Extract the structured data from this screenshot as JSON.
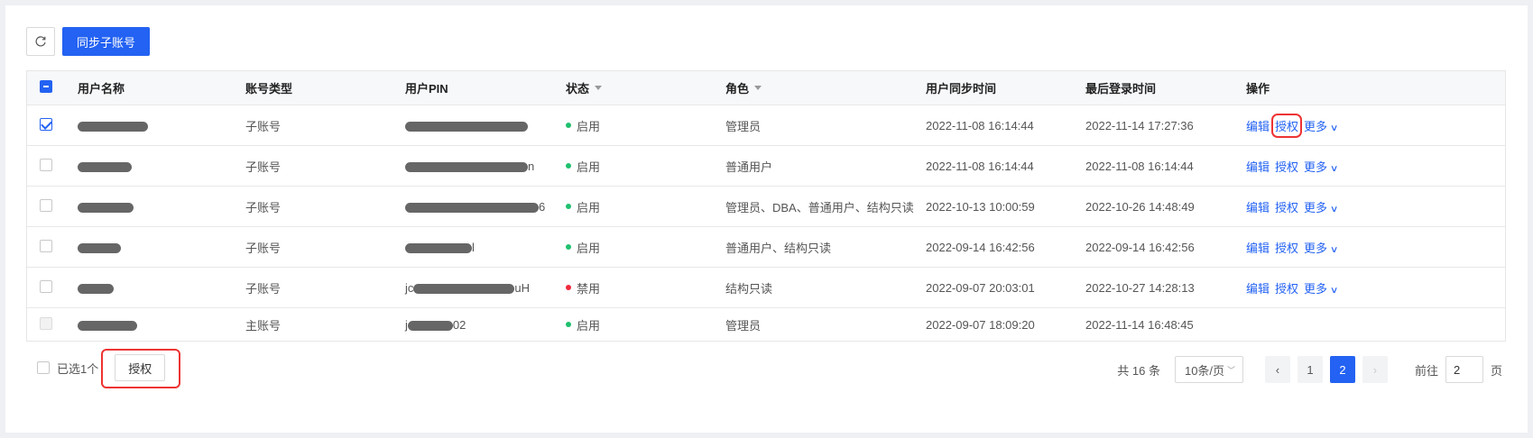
{
  "toolbar": {
    "refresh_icon": "refresh-icon",
    "sync_button": "同步子账号"
  },
  "table": {
    "headers": {
      "name": "用户名称",
      "type": "账号类型",
      "pin": "用户PIN",
      "status": "状态",
      "role": "角色",
      "sync_time": "用户同步时间",
      "login_time": "最后登录时间",
      "ops": "操作"
    },
    "ops_labels": {
      "edit": "编辑",
      "auth": "授权",
      "more": "更多"
    },
    "rows": [
      {
        "checked": true,
        "pin_suffix": "",
        "type": "子账号",
        "status": "启用",
        "status_color": "#1fc06f",
        "role": "管理员",
        "sync": "2022-11-08 16:14:44",
        "login": "2022-11-14 17:27:36"
      },
      {
        "checked": false,
        "pin_suffix": "n",
        "type": "子账号",
        "status": "启用",
        "status_color": "#1fc06f",
        "role": "普通用户",
        "sync": "2022-11-08 16:14:44",
        "login": "2022-11-08 16:14:44"
      },
      {
        "checked": false,
        "pin_suffix": "6",
        "type": "子账号",
        "status": "启用",
        "status_color": "#1fc06f",
        "role": "管理员、DBA、普通用户、结构只读",
        "sync": "2022-10-13 10:00:59",
        "login": "2022-10-26 14:48:49"
      },
      {
        "checked": false,
        "pin_suffix": "l",
        "type": "子账号",
        "status": "启用",
        "status_color": "#1fc06f",
        "role": "普通用户、结构只读",
        "sync": "2022-09-14 16:42:56",
        "login": "2022-09-14 16:42:56"
      },
      {
        "checked": false,
        "pin_prefix": "jc",
        "pin_suffix": "uH",
        "type": "子账号",
        "status": "禁用",
        "status_color": "#f0283c",
        "role": "结构只读",
        "sync": "2022-09-07 20:03:01",
        "login": "2022-10-27 14:28:13"
      },
      {
        "checked": false,
        "disabled": true,
        "pin_prefix": "j",
        "pin_suffix": "02",
        "type": "主账号",
        "status": "启用",
        "status_color": "#1fc06f",
        "role": "管理员",
        "sync": "2022-09-07 18:09:20",
        "login": "2022-11-14 16:48:45"
      }
    ]
  },
  "footer": {
    "selected": "已选1个",
    "auth_button": "授权",
    "total": "共 16 条",
    "page_size": "10条/页",
    "pages": [
      "1",
      "2"
    ],
    "current_page": "2",
    "goto_label": "前往",
    "goto_value": "2",
    "page_unit": "页"
  },
  "colors": {
    "accent": "#2362f2",
    "highlight": "#e33333"
  }
}
